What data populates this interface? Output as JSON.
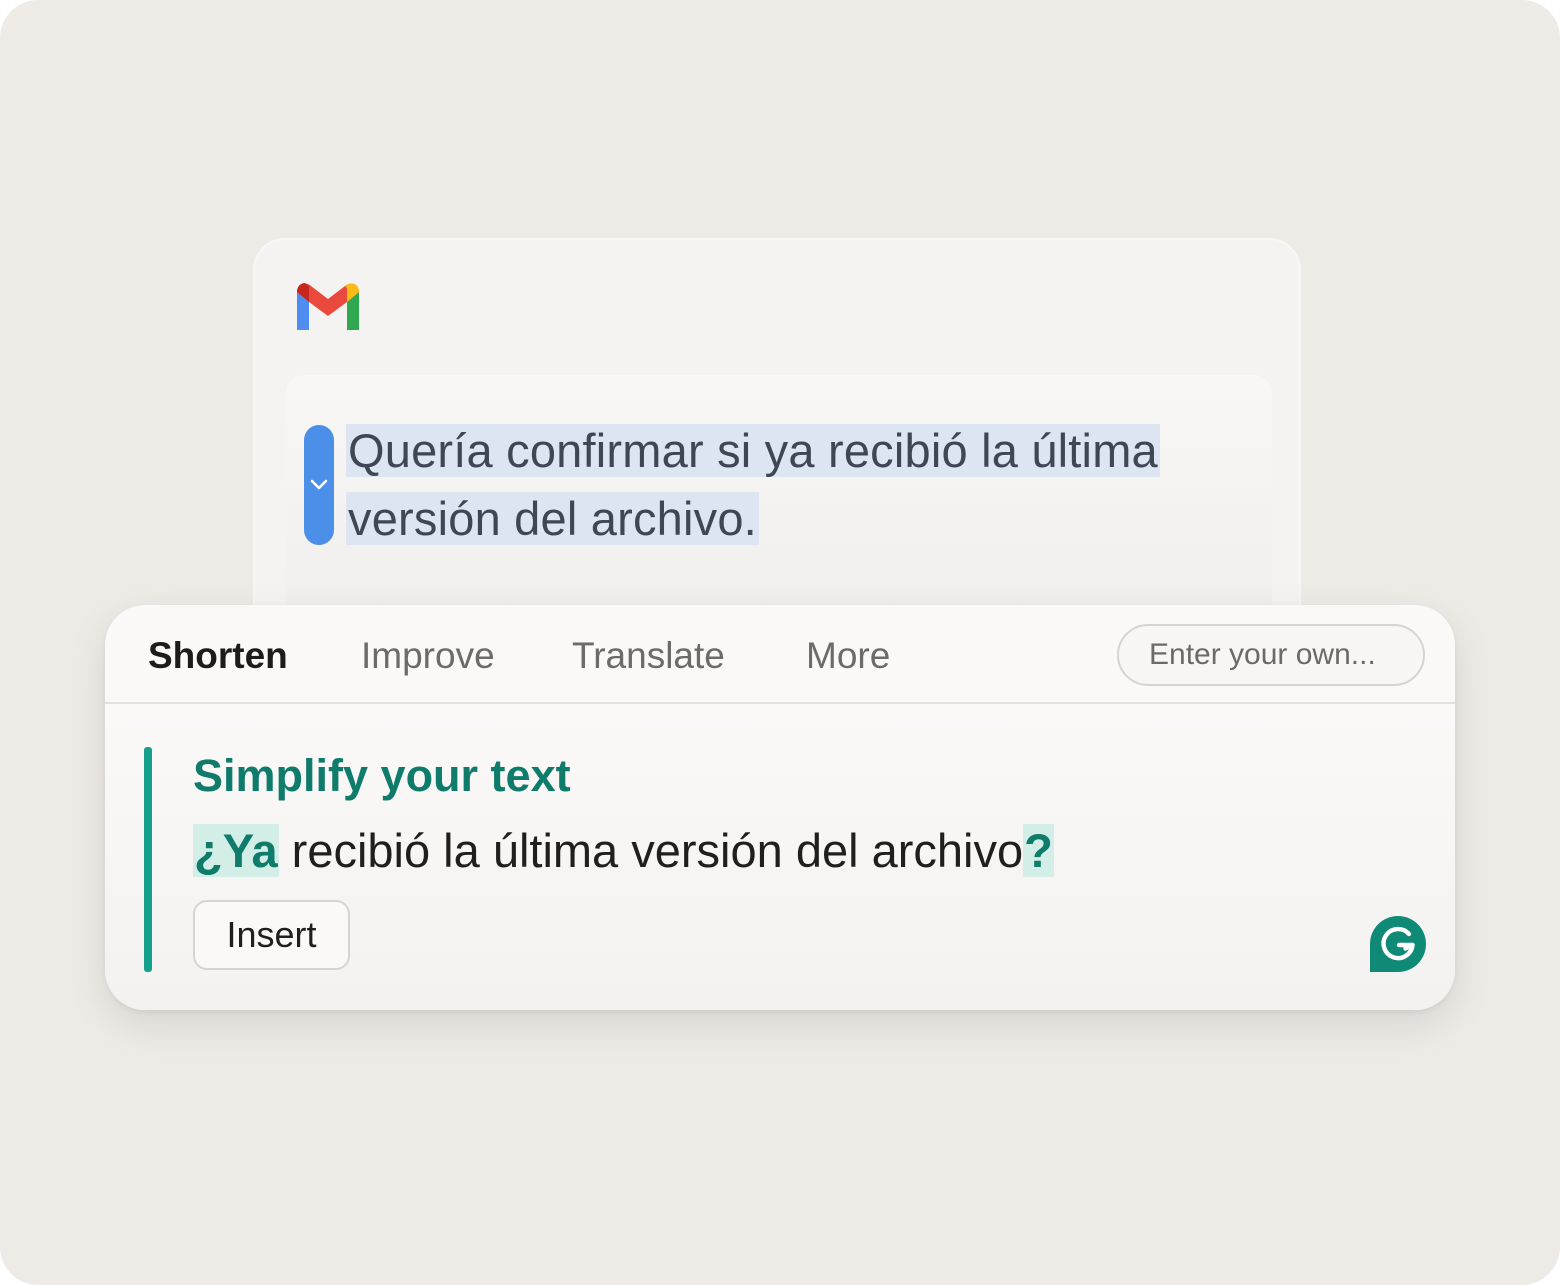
{
  "compose": {
    "selected_line_1": "Quería confirmar si ya recibió la última",
    "selected_line_2": "versión del archivo."
  },
  "popup": {
    "tabs": [
      {
        "label": "Shorten",
        "active": true
      },
      {
        "label": "Improve",
        "active": false
      },
      {
        "label": "Translate",
        "active": false
      },
      {
        "label": "More",
        "active": false
      }
    ],
    "own_prompt_placeholder": "Enter your own...",
    "suggestion": {
      "title": "Simplify your text",
      "inserted_prefix": "¿Ya",
      "body": " recibió la última versión del archivo",
      "inserted_suffix": "?"
    },
    "insert_label": "Insert"
  },
  "colors": {
    "accent_green": "#15a08c",
    "title_green": "#0f7c6b",
    "highlight_blue": "#dde4f2",
    "handle_blue": "#4b8fe8",
    "background": "#eeebe7"
  },
  "icons": [
    "gmail-logo-icon",
    "chevron-down-icon",
    "grammarly-logo-icon"
  ]
}
